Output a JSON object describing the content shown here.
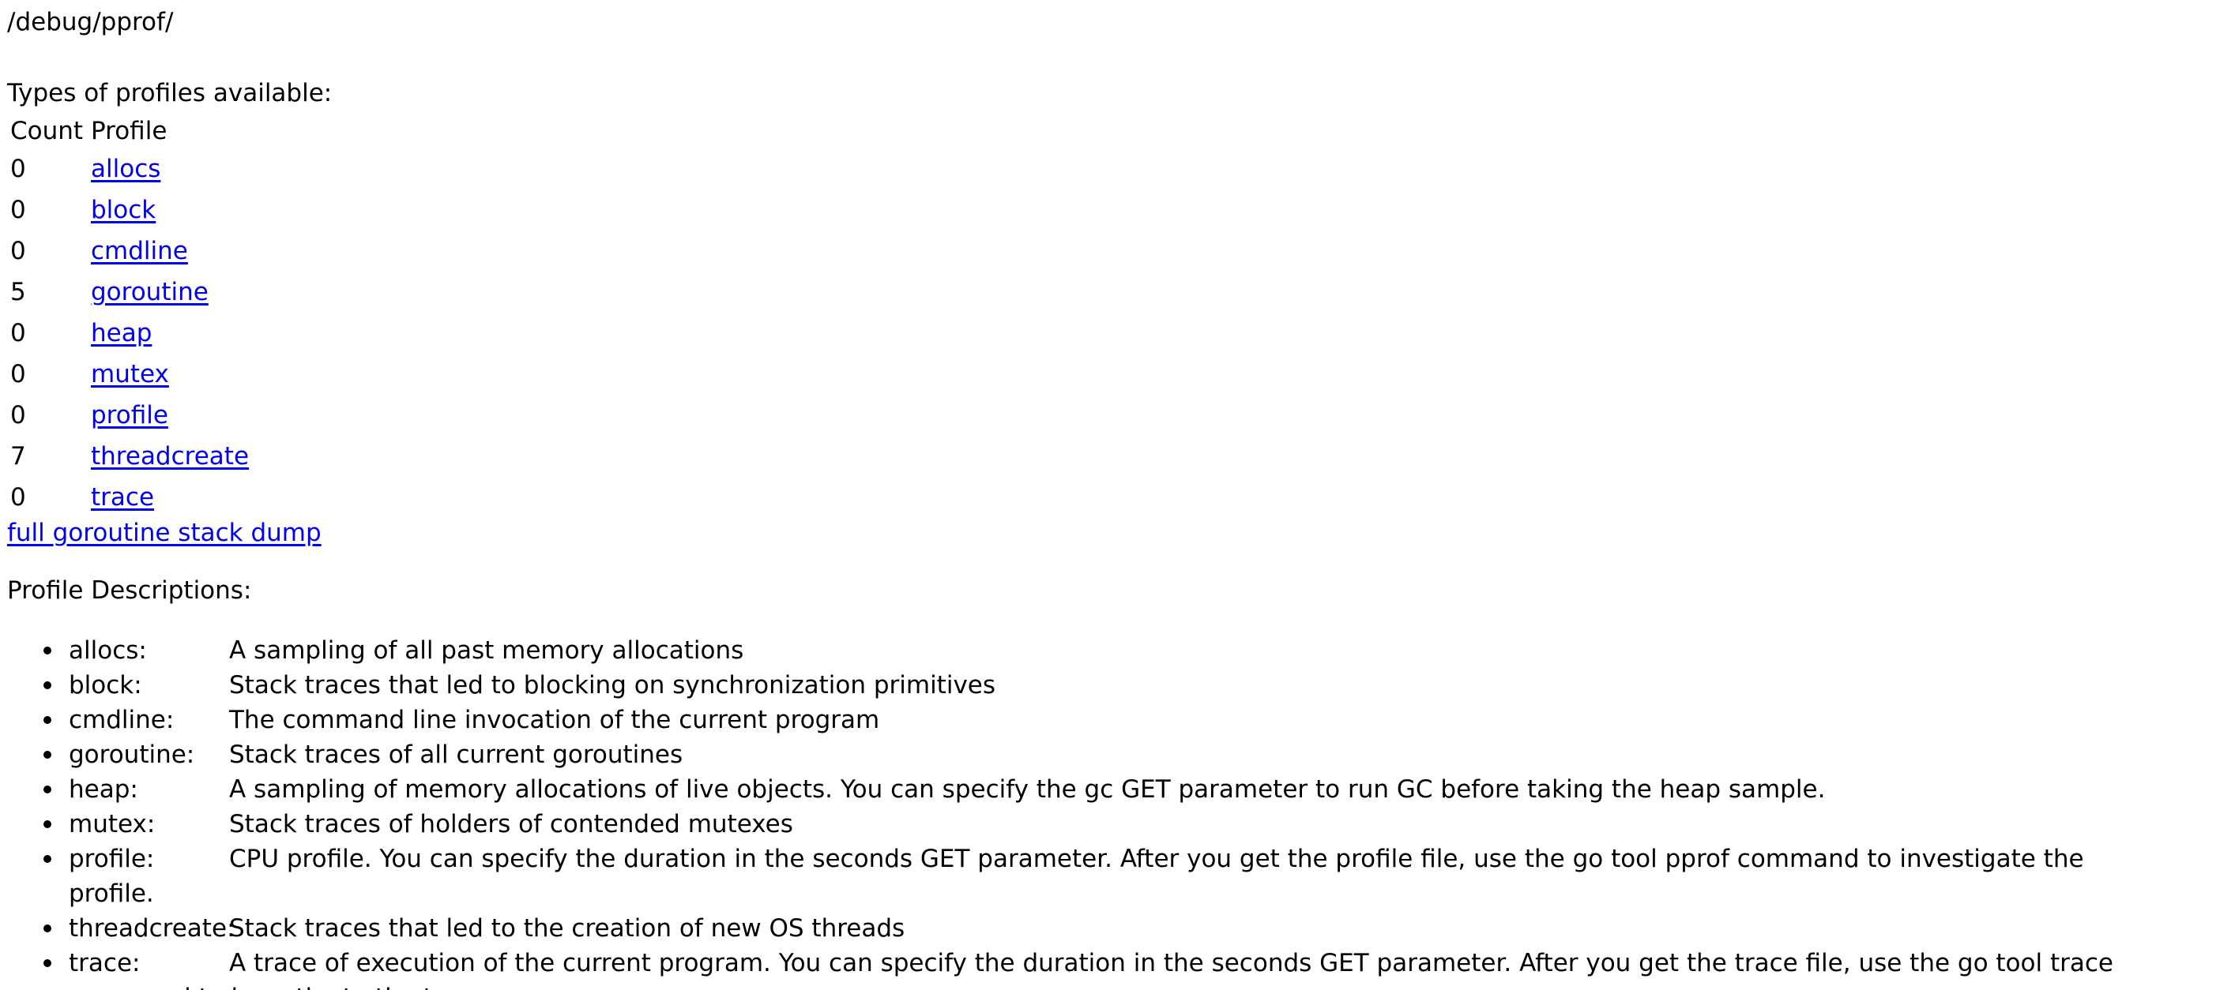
{
  "header": {
    "path": "/debug/pprof/"
  },
  "profiles_section": {
    "label": "Types of profiles available:",
    "columns": [
      "Count",
      "Profile"
    ],
    "rows": [
      {
        "count": "0",
        "profile": "allocs"
      },
      {
        "count": "0",
        "profile": "block"
      },
      {
        "count": "0",
        "profile": "cmdline"
      },
      {
        "count": "5",
        "profile": "goroutine"
      },
      {
        "count": "0",
        "profile": "heap"
      },
      {
        "count": "0",
        "profile": "mutex"
      },
      {
        "count": "0",
        "profile": "profile"
      },
      {
        "count": "7",
        "profile": "threadcreate"
      },
      {
        "count": "0",
        "profile": "trace"
      }
    ],
    "stack_dump_link": "full goroutine stack dump"
  },
  "descriptions_section": {
    "label": "Profile Descriptions:",
    "items": [
      {
        "name": "allocs:",
        "text": "A sampling of all past memory allocations"
      },
      {
        "name": "block:",
        "text": "Stack traces that led to blocking on synchronization primitives"
      },
      {
        "name": "cmdline:",
        "text": "The command line invocation of the current program"
      },
      {
        "name": "goroutine:",
        "text": "Stack traces of all current goroutines"
      },
      {
        "name": "heap:",
        "text": "A sampling of memory allocations of live objects. You can specify the gc GET parameter to run GC before taking the heap sample."
      },
      {
        "name": "mutex:",
        "text": "Stack traces of holders of contended mutexes"
      },
      {
        "name": "profile:",
        "text": "CPU profile. You can specify the duration in the seconds GET parameter. After you get the profile file, use the go tool pprof command to investigate the profile."
      },
      {
        "name": "threadcreate:",
        "text": "Stack traces that led to the creation of new OS threads"
      },
      {
        "name": "trace:",
        "text": "A trace of execution of the current program. You can specify the duration in the seconds GET parameter. After you get the trace file, use the go tool trace command to investigate the trace."
      }
    ]
  },
  "colors": {
    "link": "#0000ee",
    "text": "#000000",
    "background": "#ffffff"
  }
}
